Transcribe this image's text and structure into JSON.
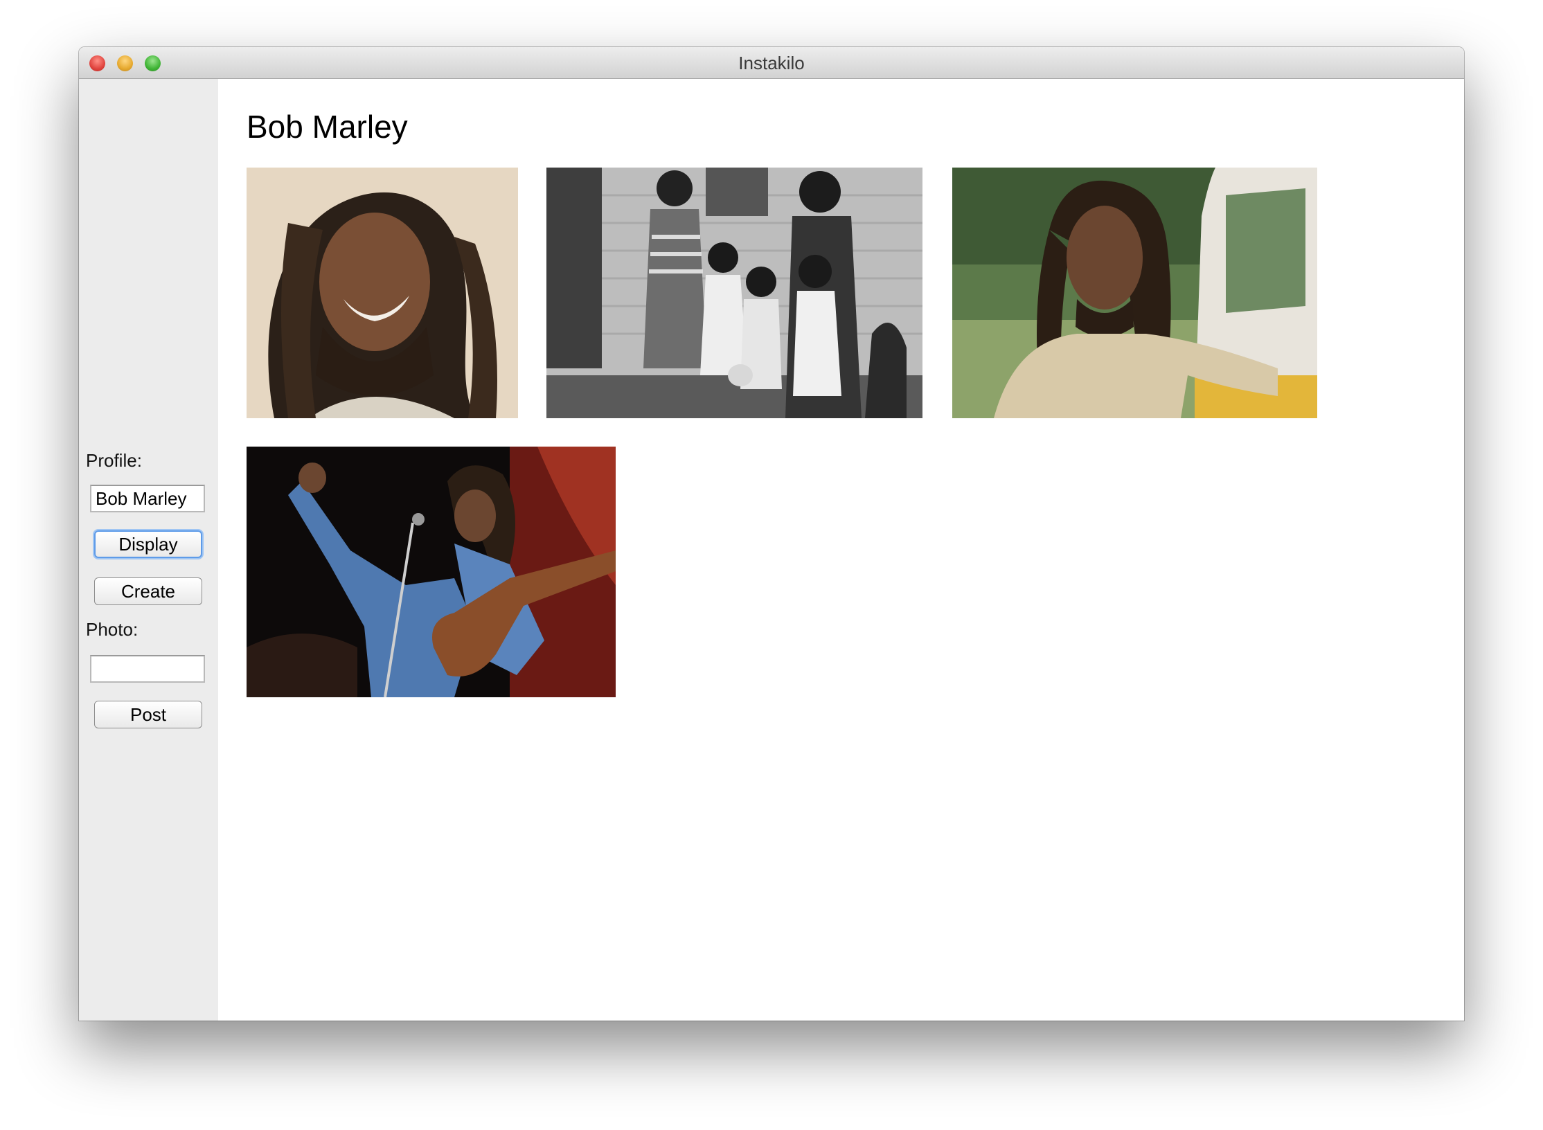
{
  "window": {
    "title": "Instakilo"
  },
  "sidebar": {
    "profile_label": "Profile:",
    "profile_value": "Bob Marley",
    "display_label": "Display",
    "create_label": "Create",
    "photo_label": "Photo:",
    "photo_value": "",
    "post_label": "Post"
  },
  "main": {
    "profile_name": "Bob Marley",
    "photos": [
      {
        "icon": "portrait-smiling-photo"
      },
      {
        "icon": "family-group-photo"
      },
      {
        "icon": "portrait-by-car-photo"
      },
      {
        "icon": "concert-performance-photo"
      }
    ]
  }
}
